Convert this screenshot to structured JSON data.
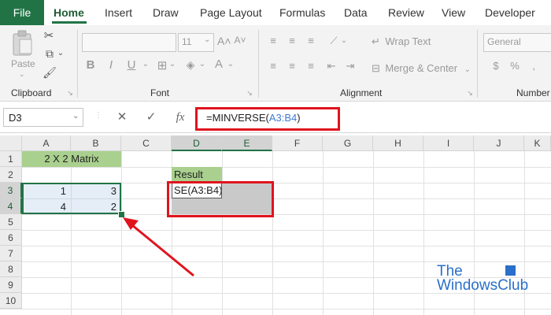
{
  "ribbon_tabs": {
    "file": "File",
    "home": "Home",
    "insert": "Insert",
    "draw": "Draw",
    "page_layout": "Page Layout",
    "formulas": "Formulas",
    "data": "Data",
    "review": "Review",
    "view": "View",
    "developer": "Developer"
  },
  "ribbon": {
    "clipboard_label": "Clipboard",
    "paste_label": "Paste",
    "font_label": "Font",
    "font_size": "11",
    "alignment_label": "Alignment",
    "wrap_text": "Wrap Text",
    "merge_center": "Merge & Center",
    "number_label": "Number",
    "number_format": "General"
  },
  "formula_bar": {
    "name_box": "D3",
    "fx": "fx",
    "formula_prefix": "=MINVERSE(",
    "formula_ref": "A3:B4",
    "formula_suffix": ")"
  },
  "sheet": {
    "columns": [
      "A",
      "B",
      "C",
      "D",
      "E",
      "F",
      "G",
      "H",
      "I",
      "J",
      "K"
    ],
    "rows": [
      "1",
      "2",
      "3",
      "4",
      "5",
      "6",
      "7",
      "8",
      "9",
      "10"
    ],
    "header_cell": "2 X 2 Matrix",
    "result_label": "Result",
    "editing_cell": "SE(A3:B4)",
    "values": {
      "a3": "1",
      "b3": "3",
      "a4": "4",
      "b4": "2"
    }
  },
  "watermark": {
    "line1": "The",
    "line2": "WindowsClub"
  }
}
